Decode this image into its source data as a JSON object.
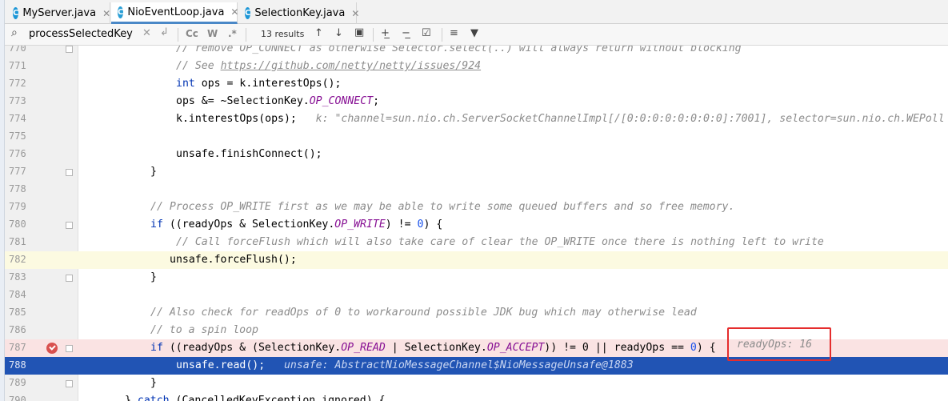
{
  "tabs": [
    {
      "label": "MyServer.java",
      "icon": "java-class-icon",
      "active": false
    },
    {
      "label": "NioEventLoop.java",
      "icon": "java-class-icon",
      "active": true
    },
    {
      "label": "SelectionKey.java",
      "icon": "java-class-icon",
      "active": false
    }
  ],
  "find": {
    "query": "processSelectedKey",
    "results": "13 results",
    "match_case_label": "Cc",
    "words_label": "W",
    "regex_label": ".*"
  },
  "code_lines": [
    {
      "num": "770",
      "text": "    // remove OP_CONNECT as otherwise Selector.select(..) will always return without blocking"
    },
    {
      "num": "771",
      "text": "    // See https://github.com/netty/netty/issues/924"
    },
    {
      "num": "772",
      "text": "    int ops = k.interestOps();"
    },
    {
      "num": "773",
      "text": "    ops &= ~SelectionKey.OP_CONNECT;"
    },
    {
      "num": "774",
      "text": "    k.interestOps(ops);"
    },
    {
      "num": "775",
      "text": ""
    },
    {
      "num": "776",
      "text": "    unsafe.finishConnect();"
    },
    {
      "num": "777",
      "text": "}"
    },
    {
      "num": "778",
      "text": ""
    },
    {
      "num": "779",
      "text": "// Process OP_WRITE first as we may be able to write some queued buffers and so free memory."
    },
    {
      "num": "780",
      "text": "if ((readyOps & SelectionKey.OP_WRITE) != 0) {"
    },
    {
      "num": "781",
      "text": "    // Call forceFlush which will also take care of clear the OP_WRITE once there is nothing left to write"
    },
    {
      "num": "782",
      "text": "   unsafe.forceFlush();"
    },
    {
      "num": "783",
      "text": "}"
    },
    {
      "num": "784",
      "text": ""
    },
    {
      "num": "785",
      "text": "// Also check for readOps of 0 to workaround possible JDK bug which may otherwise lead"
    },
    {
      "num": "786",
      "text": "// to a spin loop"
    },
    {
      "num": "787",
      "text": "if ((readyOps & (SelectionKey.OP_READ | SelectionKey.OP_ACCEPT)) != 0 || readyOps == 0) {"
    },
    {
      "num": "788",
      "text": "    unsafe.read();"
    },
    {
      "num": "789",
      "text": "}"
    },
    {
      "num": "790",
      "text": "} catch (CancelledKeyException ignored) {"
    }
  ],
  "inline_hints": {
    "l774": "k: \"channel=sun.nio.ch.ServerSocketChannelImpl[/[0:0:0:0:0:0:0:0]:7001], selector=sun.nio.ch.WEPoll",
    "l787": "readyOps: 16",
    "l788": "unsafe: AbstractNioMessageChannel$NioMessageUnsafe@1883"
  },
  "colors": {
    "keyword": "#0033b3",
    "comment": "#8c8c8c",
    "field": "#871094",
    "number": "#1750eb",
    "execution_line": "#2154b4",
    "breakpoint_line": "#fae3e3",
    "breakpoint": "#d9514f",
    "highlight_box": "#e52d2d"
  }
}
